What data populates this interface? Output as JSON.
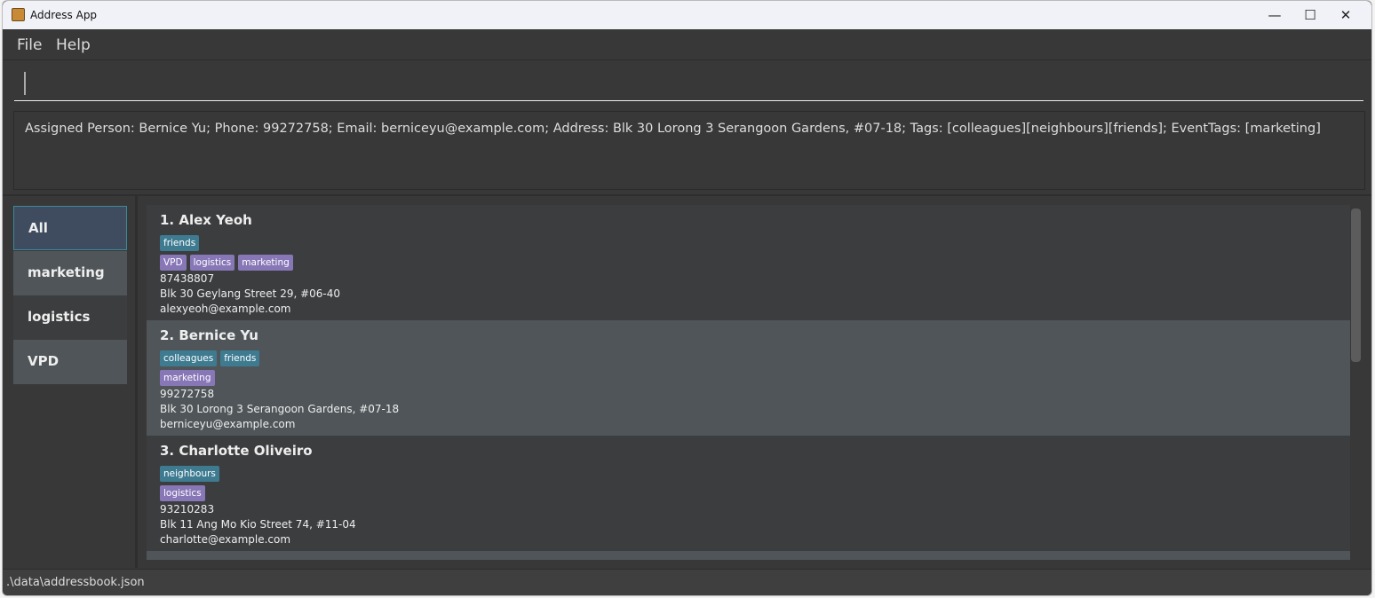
{
  "window": {
    "title": "Address App"
  },
  "menu": [
    "File",
    "Help"
  ],
  "command_box": {
    "value": ""
  },
  "result_display": "Assigned Person: Bernice Yu; Phone: 99272758; Email: berniceyu@example.com; Address: Blk 30 Lorong 3 Serangoon Gardens, #07-18; Tags: [colleagues][neighbours][friends]; EventTags: [marketing]",
  "events": [
    {
      "label": "All",
      "selected": true
    },
    {
      "label": "marketing"
    },
    {
      "label": "logistics"
    },
    {
      "label": "VPD"
    }
  ],
  "persons": [
    {
      "name": "1.  Alex Yeoh",
      "tags": [
        "friends"
      ],
      "event_tags": [
        "VPD",
        "logistics",
        "marketing"
      ],
      "phone": "87438807",
      "address": "Blk 30 Geylang Street 29, #06-40",
      "email": "alexyeoh@example.com"
    },
    {
      "name": "2.  Bernice Yu",
      "tags": [
        "colleagues",
        "friends"
      ],
      "event_tags": [
        "marketing"
      ],
      "phone": "99272758",
      "address": "Blk 30 Lorong 3 Serangoon Gardens, #07-18",
      "email": "berniceyu@example.com"
    },
    {
      "name": "3.  Charlotte Oliveiro",
      "tags": [
        "neighbours"
      ],
      "event_tags": [
        "logistics"
      ],
      "phone": "93210283",
      "address": "Blk 11 Ang Mo Kio Street 74, #11-04",
      "email": "charlotte@example.com"
    }
  ],
  "status_bar": ".\\data\\addressbook.json",
  "colors": {
    "tag": "#3e7b91",
    "event_tag": "#8877b7",
    "selected_event": "#3f4b5e"
  }
}
